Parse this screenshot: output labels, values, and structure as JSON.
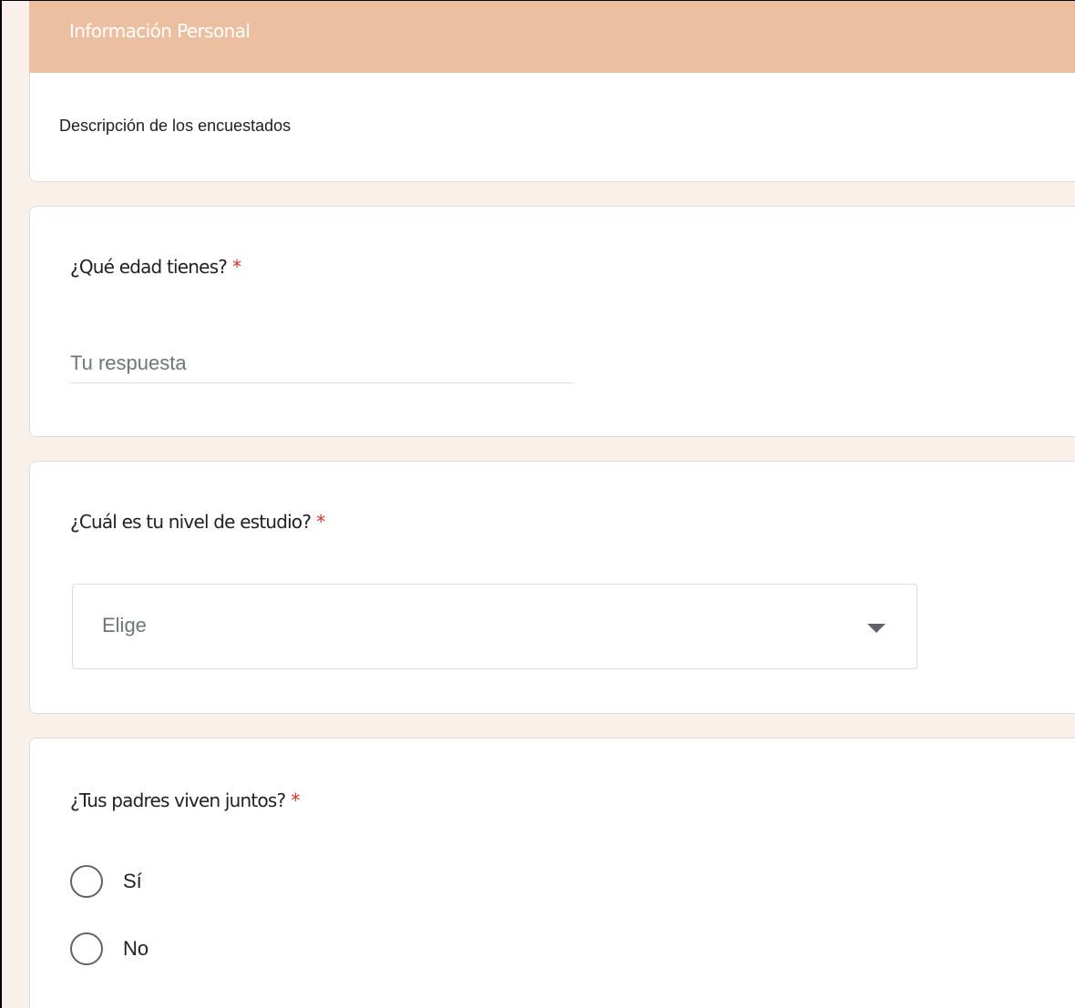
{
  "section": {
    "title": "Información Personal",
    "description": "Descripción de los encuestados"
  },
  "questions": [
    {
      "label": "¿Qué edad tienes?",
      "required_mark": "*",
      "type": "short-text",
      "placeholder": "Tu respuesta"
    },
    {
      "label": "¿Cuál es tu nivel de estudio?",
      "required_mark": "*",
      "type": "dropdown",
      "selected": "Elige"
    },
    {
      "label": "¿Tus padres viven juntos?",
      "required_mark": "*",
      "type": "radio",
      "options": [
        "Sí",
        "No"
      ]
    }
  ],
  "colors": {
    "header": "#ecbfa1",
    "background": "#faf0ea",
    "required": "#d93025"
  },
  "icons": {
    "dropdown": "caret-down-icon",
    "radio": "radio-unchecked-icon"
  }
}
